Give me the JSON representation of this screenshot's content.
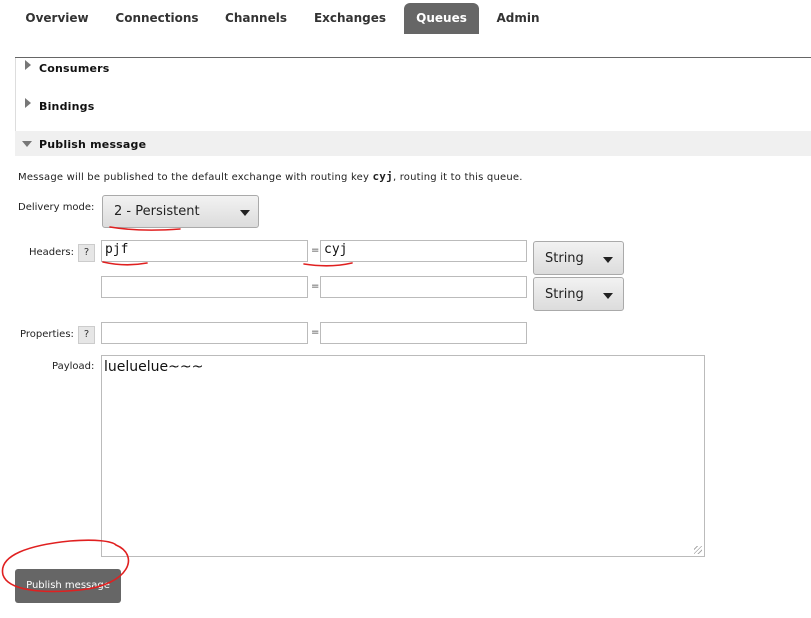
{
  "nav": {
    "tabs": [
      {
        "label": "Overview",
        "active": false
      },
      {
        "label": "Connections",
        "active": false
      },
      {
        "label": "Channels",
        "active": false
      },
      {
        "label": "Exchanges",
        "active": false
      },
      {
        "label": "Queues",
        "active": true
      },
      {
        "label": "Admin",
        "active": false
      }
    ]
  },
  "sections": {
    "consumers": "Consumers",
    "bindings": "Bindings",
    "publish": "Publish message"
  },
  "publish": {
    "description_prefix": "Message will be published to the default exchange with routing key ",
    "routing_key": "cyj",
    "description_suffix": ", routing it to this queue.",
    "delivery_mode_label": "Delivery mode:",
    "delivery_mode_value": "2 - Persistent",
    "headers_label": "Headers:",
    "help_glyph": "?",
    "headers": [
      {
        "key": "pjf",
        "value": "cyj",
        "type": "String"
      },
      {
        "key": "",
        "value": "",
        "type": "String"
      }
    ],
    "properties_label": "Properties:",
    "properties": [
      {
        "key": "",
        "value": ""
      }
    ],
    "equals": "=",
    "payload_label": "Payload:",
    "payload_value": "lueluelue~~~",
    "button_label": "Publish message"
  },
  "annotation_color": "#e02020"
}
